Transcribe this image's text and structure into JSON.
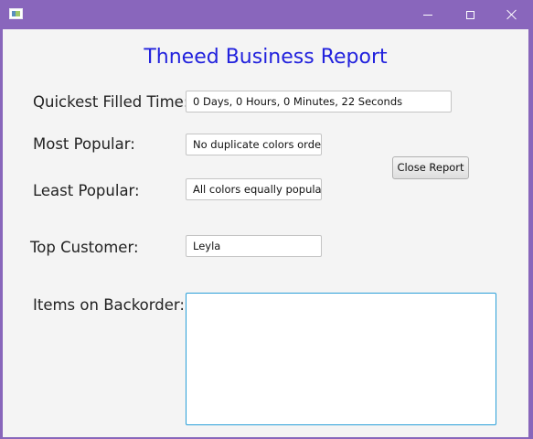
{
  "window": {
    "controls": {
      "minimize_icon": "minimize-icon",
      "maximize_icon": "maximize-icon",
      "close_icon": "close-icon"
    }
  },
  "report": {
    "title": "Thneed Business Report",
    "quickest": {
      "label": "Quickest Filled Time:",
      "value": "0 Days, 0 Hours, 0 Minutes, 22 Seconds"
    },
    "most_popular": {
      "label": "Most Popular:",
      "value": "No duplicate colors order"
    },
    "least_popular": {
      "label": "Least Popular:",
      "value": "All colors equally popular"
    },
    "top_customer": {
      "label": "Top Customer:",
      "value": "Leyla"
    },
    "backorder": {
      "label": "Items on Backorder:",
      "value": ""
    },
    "close_button_label": "Close Report"
  },
  "colors": {
    "titlebar": "#8966bc",
    "title_text": "#2222dd",
    "focus_border": "#2a9fd8"
  }
}
